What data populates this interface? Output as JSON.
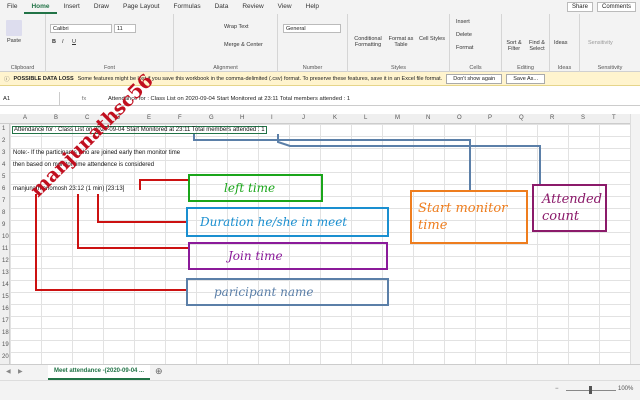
{
  "tabs": [
    "File",
    "Home",
    "Insert",
    "Draw",
    "Page Layout",
    "Formulas",
    "Data",
    "Review",
    "View",
    "Help"
  ],
  "active_tab": "Home",
  "share_label": "Share",
  "comments_label": "Comments",
  "ribbon": {
    "paste": "Paste",
    "font_name": "Calibri",
    "font_size": "11",
    "wrap_text": "Wrap Text",
    "merge_center": "Merge & Center",
    "number_format": "General",
    "conditional_formatting": "Conditional Formatting",
    "format_as_table": "Format as Table",
    "cell_styles": "Cell Styles",
    "insert": "Insert",
    "delete": "Delete",
    "format": "Format",
    "sort_filter": "Sort & Filter",
    "find_select": "Find & Select",
    "ideas": "Ideas",
    "sensitivity": "Sensitivity",
    "groups": [
      "Clipboard",
      "Font",
      "Alignment",
      "Number",
      "Styles",
      "Cells",
      "Editing",
      "Ideas",
      "Sensitivity"
    ]
  },
  "message_bar": {
    "title": "POSSIBLE DATA LOSS",
    "text": "Some features might be lost if you save this workbook in the comma-delimited (.csv) format. To preserve these features, save it in an Excel file format.",
    "dont_show": "Don't show again",
    "save_as": "Save As..."
  },
  "formula_bar": {
    "name_box": "A1",
    "fx": "fx",
    "content": "Attendance for : Class List on 2020-09-04 Start Monitored at 23:11 Total members attended : 1"
  },
  "columns": [
    "A",
    "B",
    "C",
    "D",
    "E",
    "F",
    "G",
    "H",
    "I",
    "J",
    "K",
    "L",
    "M",
    "N",
    "O",
    "P",
    "Q",
    "R",
    "S",
    "T"
  ],
  "rows": [
    "1",
    "2",
    "3",
    "4",
    "5",
    "6",
    "7",
    "8",
    "9",
    "10",
    "11",
    "12",
    "13",
    "14",
    "15",
    "16",
    "17",
    "18",
    "19",
    "20"
  ],
  "cells": {
    "r1": "Attendance for : Class List on 2020-09-04 Start Monitored at 23:11 Total members attended : 1",
    "r3": "Note:- If the participants who are joined early then monitor time",
    "r4": "then based on monitor time attendence is considered",
    "r6": "manjunath anomosh 23:12  (1 min)  [23:13]"
  },
  "annotations": {
    "left_time": "left time",
    "duration": "Duration he/she in meet",
    "join_time": "Join time",
    "participant_name": "paricipant name",
    "start_monitor": "Start monitor time",
    "attended_count": "Attended count",
    "watermark": "manjunathsc56"
  },
  "annotation_colors": {
    "left_time": "#1aa51a",
    "duration": "#1a8fd0",
    "join_time": "#8b1a9a",
    "participant_name": "#5b7fa8",
    "start_monitor": "#ee7d1e",
    "attended_count": "#8b1a6a",
    "red_lines": "#cc1111"
  },
  "sheet_tab": "Meet attendance -(2020-09-04 ...",
  "zoom": "100%"
}
